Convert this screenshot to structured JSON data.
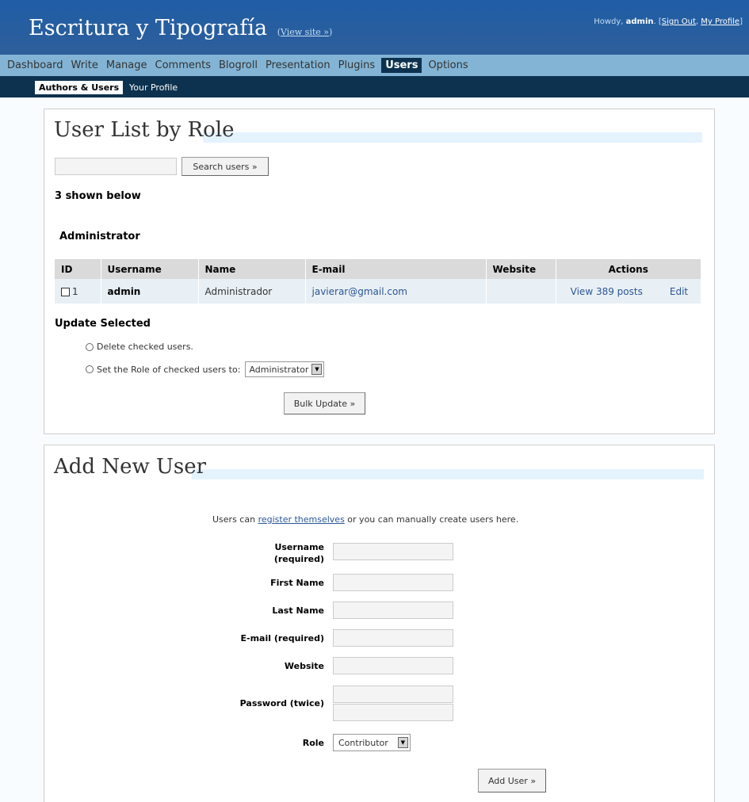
{
  "header": {
    "site_title": "Escritura y Tipografía",
    "view_site": "View site »",
    "howdy_prefix": "Howdy, ",
    "user": "admin",
    "sign_out": "Sign Out",
    "my_profile": "My Profile"
  },
  "menu": [
    "Dashboard",
    "Write",
    "Manage",
    "Comments",
    "Blogroll",
    "Presentation",
    "Plugins",
    "Users",
    "Options"
  ],
  "submenu": {
    "authors_users": "Authors & Users",
    "your_profile": "Your Profile"
  },
  "userlist": {
    "heading": "User List by Role",
    "search_value": "",
    "search_button": "Search users »",
    "shown": "3 shown below",
    "role": "Administrator",
    "columns": {
      "id": "ID",
      "username": "Username",
      "name": "Name",
      "email": "E-mail",
      "website": "Website",
      "actions": "Actions"
    },
    "row": {
      "id": "1",
      "username": "admin",
      "name": "Administrador",
      "email": "javierar@gmail.com",
      "website": "",
      "view_posts": "View 389 posts",
      "edit": "Edit"
    },
    "update_heading": "Update Selected",
    "delete_option": "Delete checked users.",
    "set_role_option": "Set the Role of checked users to:",
    "role_select": "Administrator",
    "bulk_button": "Bulk Update »"
  },
  "adduser": {
    "heading": "Add New User",
    "intro_before": "Users can ",
    "intro_link": "register themselves",
    "intro_after": " or you can manually create users here.",
    "username_label_1": "Username",
    "username_label_2": "(required)",
    "first_name_label": "First Name",
    "last_name_label": "Last Name",
    "email_label": "E-mail (required)",
    "website_label": "Website",
    "password_label": "Password (twice)",
    "role_label": "Role",
    "role_select": "Contributor",
    "add_button": "Add User »"
  },
  "colors": {
    "header": "#2e5f9a",
    "menu": "#83b4d5",
    "submenu": "#0d324f",
    "link": "#2b5595"
  }
}
